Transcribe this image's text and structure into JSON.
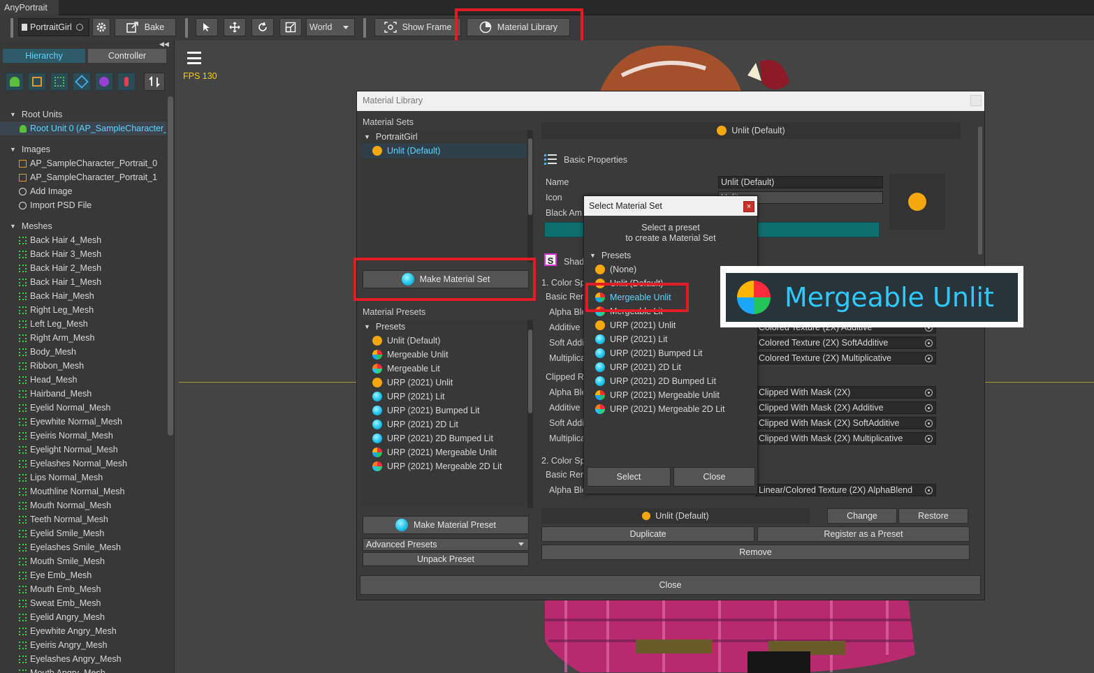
{
  "app": {
    "title": "AnyPortrait"
  },
  "toolbar": {
    "portrait_name": "PortraitGirl",
    "bake_label": "Bake",
    "world_label": "World",
    "show_frame_label": "Show Frame",
    "material_library_label": "Material Library"
  },
  "left_panel": {
    "tabs": [
      "Hierarchy",
      "Controller"
    ],
    "root_units_label": "Root Units",
    "root_unit": "Root Unit 0 (AP_SampleCharacter_",
    "images_label": "Images",
    "images": [
      "AP_SampleCharacter_Portrait_0",
      "AP_SampleCharacter_Portrait_1"
    ],
    "add_image": "Add Image",
    "import_psd": "Import PSD File",
    "meshes_label": "Meshes",
    "meshes": [
      "Back Hair 4_Mesh",
      "Back Hair 3_Mesh",
      "Back Hair 2_Mesh",
      "Back Hair 1_Mesh",
      "Back Hair_Mesh",
      "Right Leg_Mesh",
      "Left Leg_Mesh",
      "Right Arm_Mesh",
      "Body_Mesh",
      "Ribbon_Mesh",
      "Head_Mesh",
      "Hairband_Mesh",
      "Eyelid Normal_Mesh",
      "Eyewhite Normal_Mesh",
      "Eyeiris Normal_Mesh",
      "Eyelight Normal_Mesh",
      "Eyelashes Normal_Mesh",
      "Lips Normal_Mesh",
      "Mouthline Normal_Mesh",
      "Mouth Normal_Mesh",
      "Teeth Normal_Mesh",
      "Eyelid Smile_Mesh",
      "Eyelashes Smile_Mesh",
      "Mouth Smile_Mesh",
      "Eye Emb_Mesh",
      "Mouth Emb_Mesh",
      "Sweat Emb_Mesh",
      "Eyelid Angry_Mesh",
      "Eyewhite Angry_Mesh",
      "Eyeiris Angry_Mesh",
      "Eyelashes Angry_Mesh",
      "Mouth Angry_Mesh"
    ]
  },
  "viewport": {
    "fps": "FPS 130"
  },
  "material_library": {
    "title": "Material Library",
    "material_sets_label": "Material Sets",
    "set_group": "PortraitGirl",
    "set_selected": "Unlit (Default)",
    "make_material_set": "Make Material Set",
    "material_presets_label": "Material Presets",
    "presets_group": "Presets",
    "presets": [
      {
        "name": "Unlit (Default)",
        "icon": "orange"
      },
      {
        "name": "Mergeable Unlit",
        "icon": "multi"
      },
      {
        "name": "Mergeable Lit",
        "icon": "multi2"
      },
      {
        "name": "URP (2021) Unlit",
        "icon": "orange"
      },
      {
        "name": "URP (2021) Lit",
        "icon": "cyan"
      },
      {
        "name": "URP (2021) Bumped Lit",
        "icon": "cyan"
      },
      {
        "name": "URP (2021) 2D Lit",
        "icon": "cyan"
      },
      {
        "name": "URP (2021) 2D Bumped Lit",
        "icon": "cyan"
      },
      {
        "name": "URP (2021) Mergeable Unlit",
        "icon": "multi"
      },
      {
        "name": "URP (2021) Mergeable 2D Lit",
        "icon": "multi2"
      }
    ],
    "make_material_preset": "Make Material Preset",
    "advanced_presets": "Advanced Presets",
    "unpack_preset": "Unpack Preset",
    "header_name": "Unlit (Default)",
    "basic_properties": "Basic Properties",
    "name_label": "Name",
    "name_value": "Unlit (Default)",
    "icon_label": "Icon",
    "icon_value": "Unlit",
    "black_am_label": "Black Am",
    "shader_label": "Shad",
    "color_space_1": "1. Color Sp",
    "basic_ren_1": "Basic Ren",
    "alpha_ble_1": "Alpha Ble",
    "additive_1": "Additive",
    "soft_addi_1": "Soft Addi",
    "multiplica_1": "Multiplica",
    "clipped_r": "Clipped R",
    "alpha_ble_2": "Alpha Ble",
    "additive_2": "Additive",
    "soft_addi_2": "Soft Addi",
    "multiplica_2": "Multiplica",
    "color_space_2": "2. Color Sp",
    "basic_ren_2": "Basic Ren",
    "alpha_ble_3": "Alpha Ble",
    "fields": {
      "additive": "Colored Texture (2X) Additive",
      "soft_additive": "Colored Texture (2X) SoftAdditive",
      "multiplicative": "Colored Texture (2X) Multiplicative",
      "clip": "Clipped With Mask (2X)",
      "clip_additive": "Clipped With Mask (2X) Additive",
      "clip_soft": "Clipped With Mask (2X) SoftAdditive",
      "clip_mult": "Clipped With Mask (2X) Multiplicative",
      "linear_alpha": "Linear/Colored Texture (2X) AlphaBlend"
    },
    "footer_name": "Unlit (Default)",
    "change": "Change",
    "restore": "Restore",
    "duplicate": "Duplicate",
    "register_preset": "Register as a Preset",
    "remove": "Remove",
    "close": "Close"
  },
  "select_dialog": {
    "title": "Select Material Set",
    "close_x": "×",
    "instruction_1": "Select a preset",
    "instruction_2": "to create a Material Set",
    "presets_group": "Presets",
    "items": [
      {
        "name": "(None)",
        "icon": "orange"
      },
      {
        "name": "Unlit (Default)",
        "icon": "orange"
      },
      {
        "name": "Mergeable Unlit",
        "icon": "multi"
      },
      {
        "name": "Mergeable Lit",
        "icon": "multi2"
      },
      {
        "name": "URP (2021) Unlit",
        "icon": "orange"
      },
      {
        "name": "URP (2021) Lit",
        "icon": "cyan"
      },
      {
        "name": "URP (2021) Bumped Lit",
        "icon": "cyan"
      },
      {
        "name": "URP (2021) 2D Lit",
        "icon": "cyan"
      },
      {
        "name": "URP (2021) 2D Bumped Lit",
        "icon": "cyan"
      },
      {
        "name": "URP (2021) Mergeable Unlit",
        "icon": "multi"
      },
      {
        "name": "URP (2021) Mergeable 2D Lit",
        "icon": "multi2"
      }
    ],
    "selected_index": 2,
    "select_button": "Select",
    "close_button": "Close"
  },
  "callout": {
    "label": "Mergeable Unlit"
  },
  "colors": {
    "accent_cyan": "#5fd4ff",
    "highlight_red": "#e21c24",
    "fps_yellow": "#f5d200"
  }
}
